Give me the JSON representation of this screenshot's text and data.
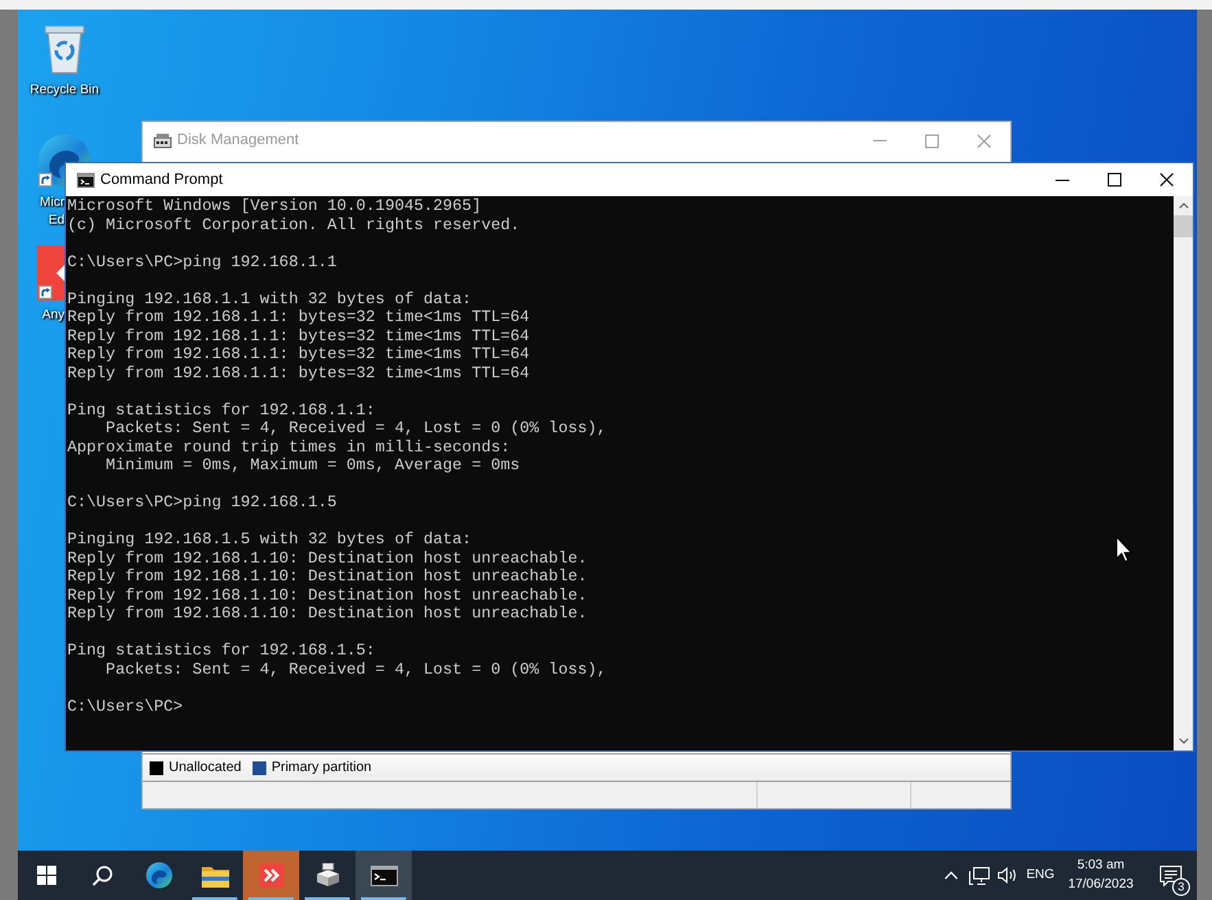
{
  "desktop": {
    "icons": [
      {
        "kind": "recycle-bin",
        "label_lines": [
          "Recycle Bin"
        ],
        "shortcut": false,
        "covered": false
      },
      {
        "kind": "edge",
        "label_lines": [
          "Micr",
          "Ed"
        ],
        "shortcut": true,
        "covered": true
      },
      {
        "kind": "anydesk",
        "label_lines": [
          "Any"
        ],
        "shortcut": true,
        "covered": true
      }
    ]
  },
  "disk_management": {
    "title": "Disk Management",
    "active": false,
    "legend": [
      {
        "label": "Unallocated",
        "color": "#000000"
      },
      {
        "label": "Primary partition",
        "color": "#1f4f93"
      }
    ]
  },
  "command_prompt": {
    "title": "Command Prompt",
    "active": true,
    "console": [
      [
        "Microsoft Windows [Version 10.0.19045.2965]",
        "(c) Microsoft Corporation. All rights reserved."
      ],
      [
        "C:\\Users\\PC>ping 192.168.1.1"
      ],
      [
        "Pinging 192.168.1.1 with 32 bytes of data:",
        "Reply from 192.168.1.1: bytes=32 time<1ms TTL=64",
        "Reply from 192.168.1.1: bytes=32 time<1ms TTL=64",
        "Reply from 192.168.1.1: bytes=32 time<1ms TTL=64",
        "Reply from 192.168.1.1: bytes=32 time<1ms TTL=64"
      ],
      [
        "Ping statistics for 192.168.1.1:",
        "    Packets: Sent = 4, Received = 4, Lost = 0 (0% loss),",
        "Approximate round trip times in milli-seconds:",
        "    Minimum = 0ms, Maximum = 0ms, Average = 0ms"
      ],
      [
        "C:\\Users\\PC>ping 192.168.1.5"
      ],
      [
        "Pinging 192.168.1.5 with 32 bytes of data:",
        "Reply from 192.168.1.10: Destination host unreachable.",
        "Reply from 192.168.1.10: Destination host unreachable.",
        "Reply from 192.168.1.10: Destination host unreachable.",
        "Reply from 192.168.1.10: Destination host unreachable."
      ],
      [
        "Ping statistics for 192.168.1.5:",
        "    Packets: Sent = 4, Received = 4, Lost = 0 (0% loss),"
      ],
      [
        "C:\\Users\\PC>"
      ]
    ]
  },
  "taskbar": {
    "apps": [
      {
        "kind": "edge",
        "running": false,
        "selected": false,
        "flashing": false
      },
      {
        "kind": "explorer",
        "running": true,
        "selected": false,
        "flashing": false
      },
      {
        "kind": "anydesk",
        "running": true,
        "selected": false,
        "flashing": true
      },
      {
        "kind": "disk-management",
        "running": true,
        "selected": false,
        "flashing": false
      },
      {
        "kind": "command-prompt",
        "running": true,
        "selected": true,
        "flashing": false
      }
    ],
    "tray": {
      "language": "ENG",
      "time": "5:03 am",
      "date": "17/06/2023",
      "notifications": "3"
    }
  }
}
